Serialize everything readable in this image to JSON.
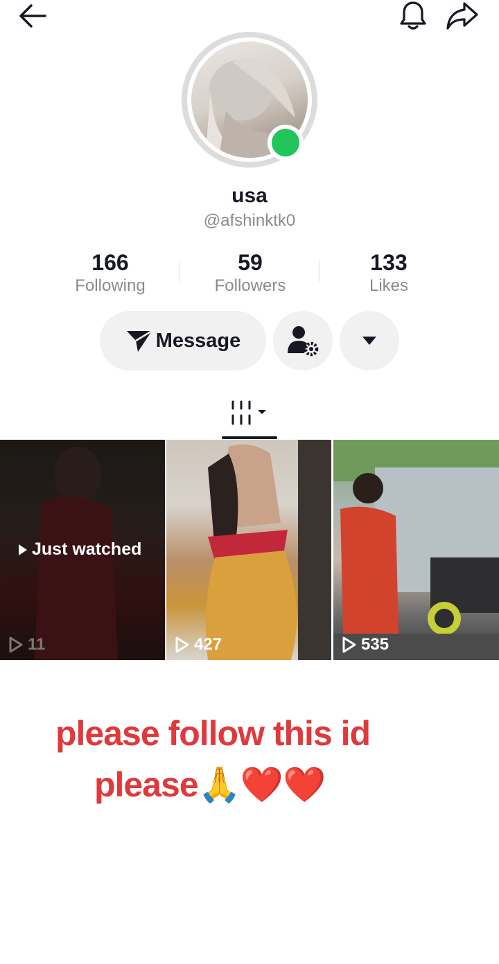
{
  "profile": {
    "username": "usa",
    "handle": "@afshinktk0",
    "online": true
  },
  "stats": [
    {
      "value": "166",
      "label": "Following"
    },
    {
      "value": "59",
      "label": "Followers"
    },
    {
      "value": "133",
      "label": "Likes"
    }
  ],
  "actions": {
    "message_label": "Message",
    "add_friend_icon": "person-gear-icon",
    "more_icon": "caret-down-icon"
  },
  "tabs": {
    "active": "videos",
    "videos_icon": "video-grid-icon"
  },
  "videos": [
    {
      "views": "11",
      "overlay": "Just watched",
      "dimmed": true
    },
    {
      "views": "427"
    },
    {
      "views": "535"
    }
  ],
  "caption": {
    "line1": "please follow this id",
    "line2": "please🙏❤️❤️"
  },
  "colors": {
    "online": "#20c65a",
    "caption": "#e0393c",
    "button_bg": "#f1f1f2"
  }
}
